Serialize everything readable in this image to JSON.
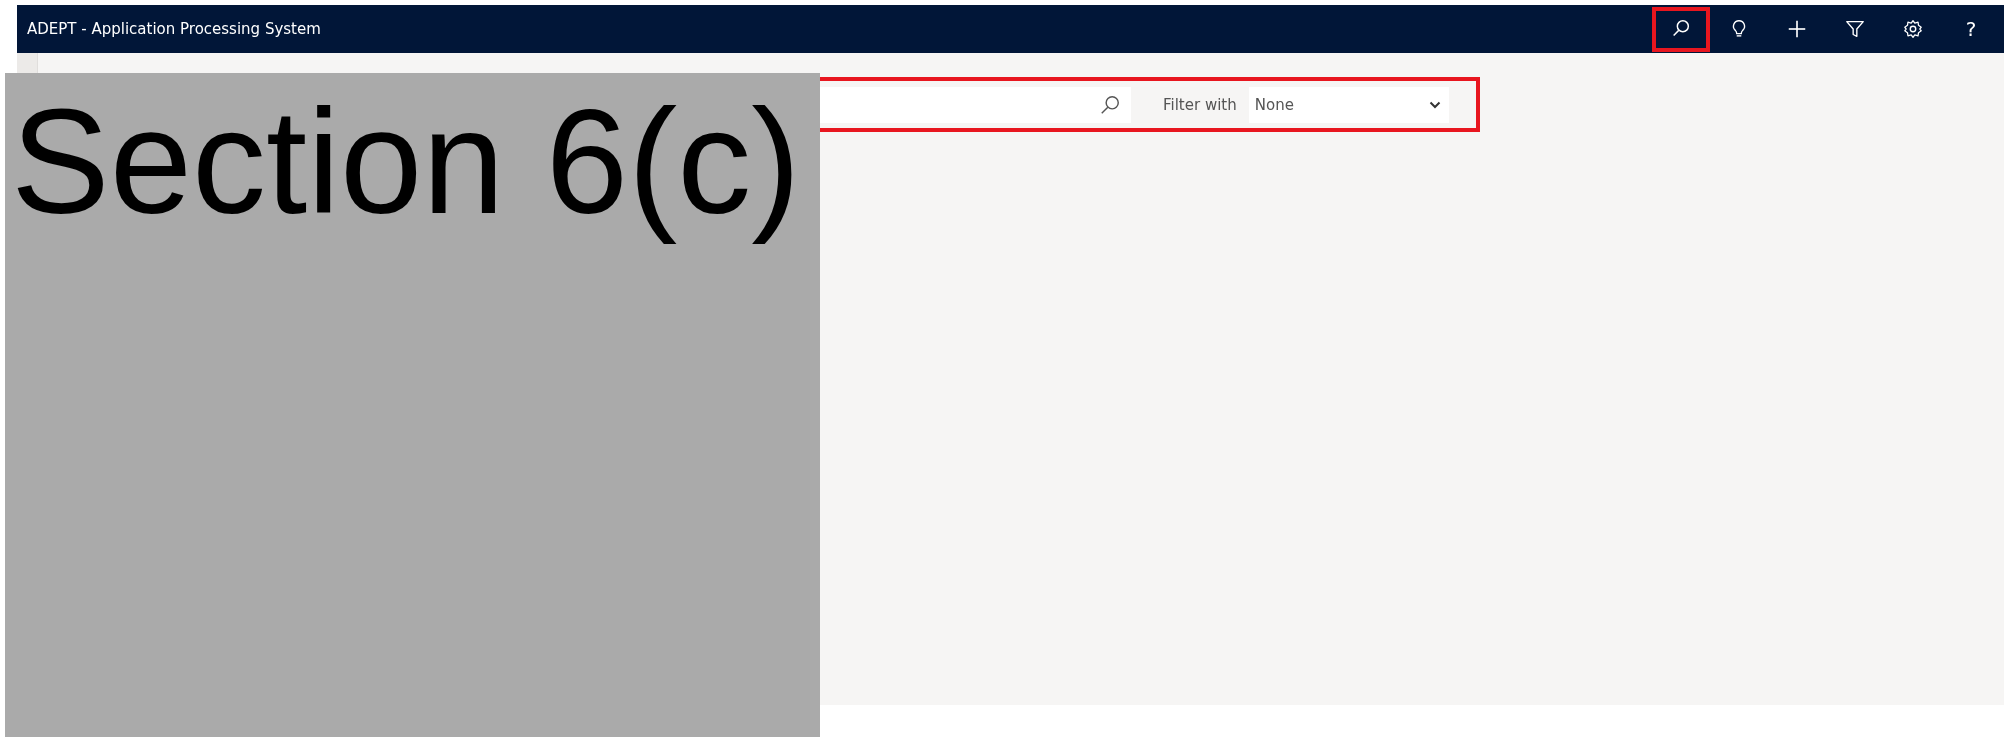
{
  "title_bar": {
    "title": "ADEPT - Application Processing System",
    "actions": [
      {
        "kind": "search",
        "highlighted": true
      },
      {
        "kind": "lightbulb",
        "highlighted": false
      },
      {
        "kind": "add",
        "highlighted": false
      },
      {
        "kind": "filter",
        "highlighted": false
      },
      {
        "kind": "settings",
        "highlighted": false
      },
      {
        "kind": "help",
        "label": "?",
        "highlighted": false
      }
    ]
  },
  "search_bar": {
    "highlighted": true,
    "filter_label": "Filter with",
    "filter_value": "None"
  },
  "redaction": {
    "label": "Section 6(c)"
  }
}
